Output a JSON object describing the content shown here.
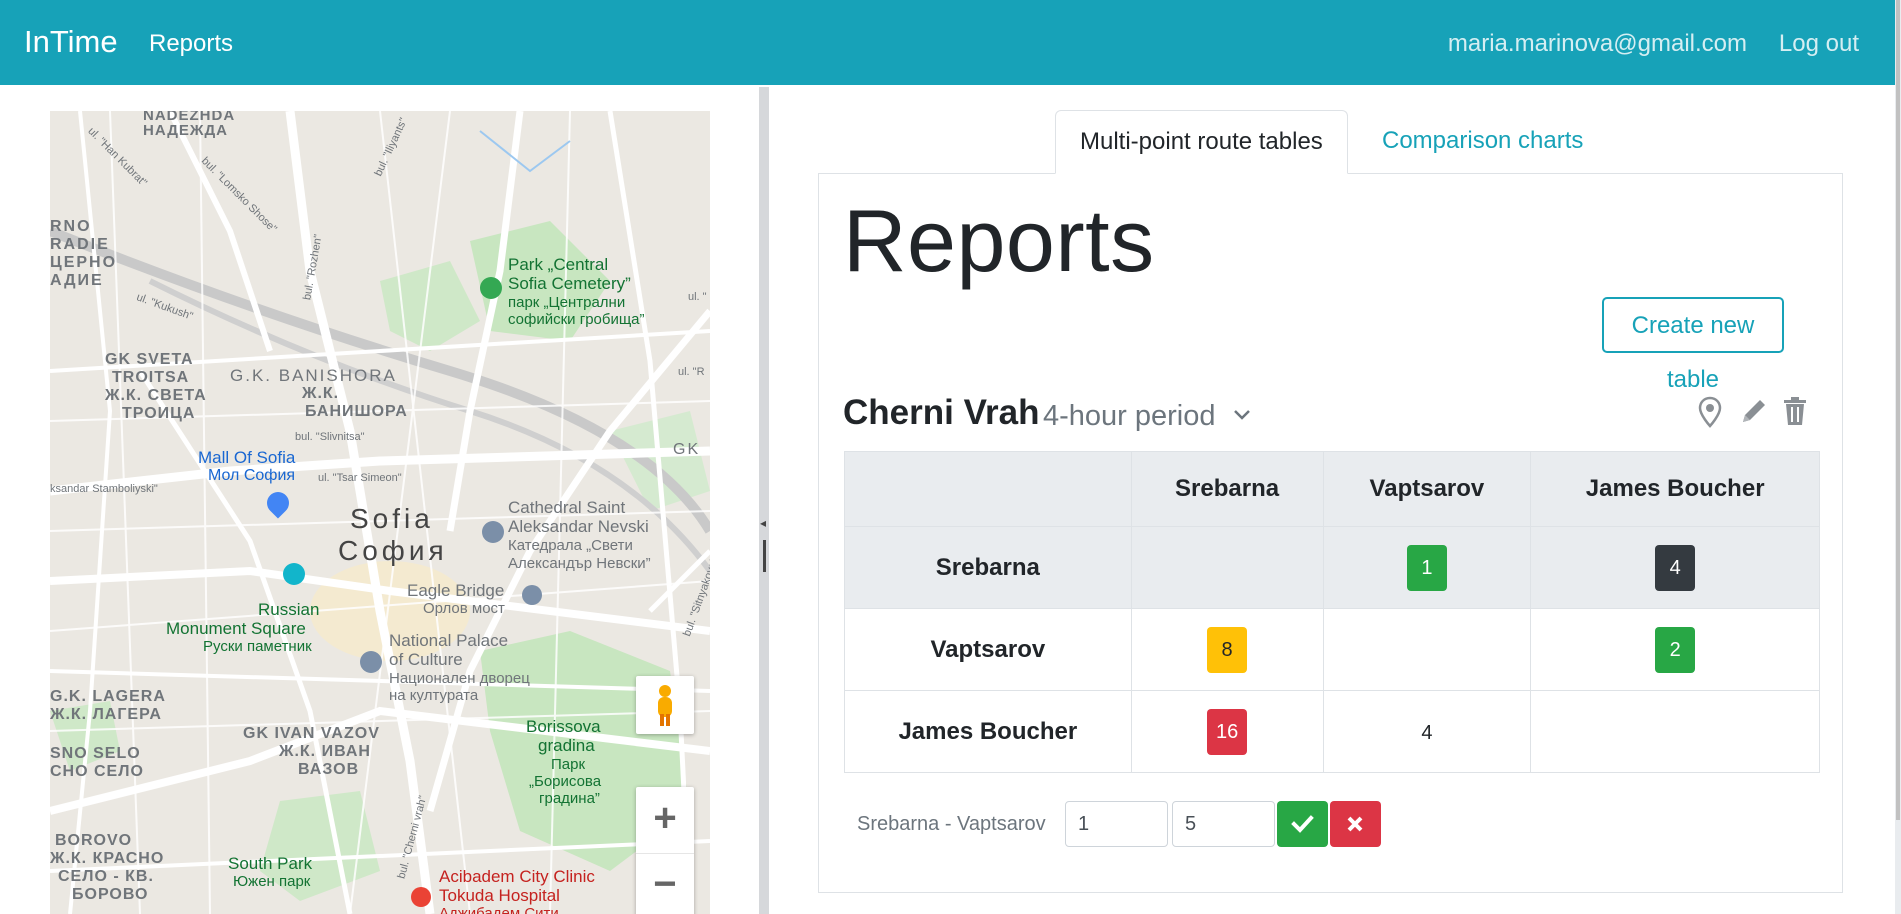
{
  "navbar": {
    "brand": "InTime",
    "reports_link": "Reports",
    "user_email": "maria.marinova@gmail.com",
    "logout": "Log out"
  },
  "map": {
    "labels": {
      "nadezhda_en": "NADEZHDA",
      "nadezhda_bg": "НАДЕЖДА",
      "orno": "RNO",
      "radie": "RADIE",
      "cherno": "ЦЕРНО",
      "radie_bg": "АДИЕ",
      "gk_sveta_troitsa": "GK SVETA",
      "troitsa": "TROITSA",
      "zhk_sveta": "Ж.К. СВЕТА",
      "troitsa_bg": "ТРОИЦА",
      "banishora": "G.K. BANISHORA",
      "zhk": "Ж.К.",
      "banishora_bg": "БАНИШОРА",
      "park_central": "Park „Central",
      "sofia_cemetery": "Sofia Cemetery”",
      "park_bg": "парк „Централни",
      "cemetery_bg": "софийски гробища”",
      "mall_of_sofia": "Mall Of Sofia",
      "mall_bg": "Мол София",
      "sofia": "Sofia",
      "sofia_bg": "София",
      "cathedral": "Cathedral Saint",
      "aleksandar": "Aleksandar Nevski",
      "cathedral_bg": "Катедрала „Свети",
      "aleksandar_bg": "Александър Невски”",
      "eagle_bridge": "Eagle Bridge",
      "eagle_bg": "Орлов мост",
      "russian": "Russian",
      "monument_square": "Monument Square",
      "monument_bg": "Руски паметник",
      "national_palace": "National Palace",
      "of_culture": "of Culture",
      "palace_bg": "Национален дворец",
      "culture_bg": "на културата",
      "lagera": "G.K. LAGERA",
      "lagera_bg": "Ж.К. ЛАГЕРА",
      "ivan_vazov": "GK IVAN VAZOV",
      "ivan_vazov_bg1": "Ж.К. ИВАН",
      "ivan_vazov_bg2": "ВАЗОВ",
      "borisova": "Borissova",
      "gradina": "gradina",
      "park_bg2": "Парк",
      "borisova_bg": "„Борисова",
      "gradina_bg": "градина”",
      "sno_selo": "SNO SELO",
      "sno_selo_bg": "СНО СЕЛО",
      "borovo": "BOROVO",
      "krasno": "Ж.К. КРАСНО",
      "selo_kv": "СЕЛО - КВ.",
      "borovo_bg": "БОРОВО",
      "south_park": "South Park",
      "south_park_bg": "Южен парк",
      "acibadem": "Acibadem City Clinic",
      "tokuda": "Tokuda Hospital",
      "acibadem_bg": "Аджибадем Сити",
      "gk": "GK",
      "ul_han_kubrat": "ul. \"Han Kubrat\"",
      "lomsko_shose": "bul. \"Lomsko Shose\"",
      "iliyants": "bul. \"Iliyants\"",
      "rozhen": "bul. \"Rozhen\"",
      "kukush": "ul. \"Kukush\"",
      "slivnitsa": "bul. \"Slivnitsa\"",
      "tsar_simeon": "ul. \"Tsar Simeon\"",
      "stamboliyski": "ksandar Stamboliyski\"",
      "cherni_vrah_st": "bul. \"Cherni vrah\"",
      "sitnyakovo": "bul. \"Sitnyakovo\"",
      "ul_r": "ul. \"R",
      "ul_quote": "ul. \""
    }
  },
  "tabs": {
    "active": "Multi-point route tables",
    "other": "Comparison charts"
  },
  "page": {
    "title": "Reports",
    "create_button": "Create new table"
  },
  "route": {
    "name": "Cherni Vrah",
    "period": "4-hour period"
  },
  "matrix": {
    "columns": [
      "",
      "Srebarna",
      "Vaptsarov",
      "James Boucher"
    ],
    "rows": [
      {
        "label": "Srebarna",
        "cells": [
          "",
          "1",
          "4"
        ]
      },
      {
        "label": "Vaptsarov",
        "cells": [
          "8",
          "",
          "2"
        ]
      },
      {
        "label": "James Boucher",
        "cells": [
          "16",
          "4",
          ""
        ]
      }
    ]
  },
  "edit": {
    "label": "Srebarna - Vaptsarov",
    "from_value": "1",
    "to_value": "5"
  },
  "colors": {
    "primary": "#17a2b8",
    "success": "#28a745",
    "dark": "#343a40",
    "warning": "#ffc107",
    "danger": "#dc3545"
  }
}
